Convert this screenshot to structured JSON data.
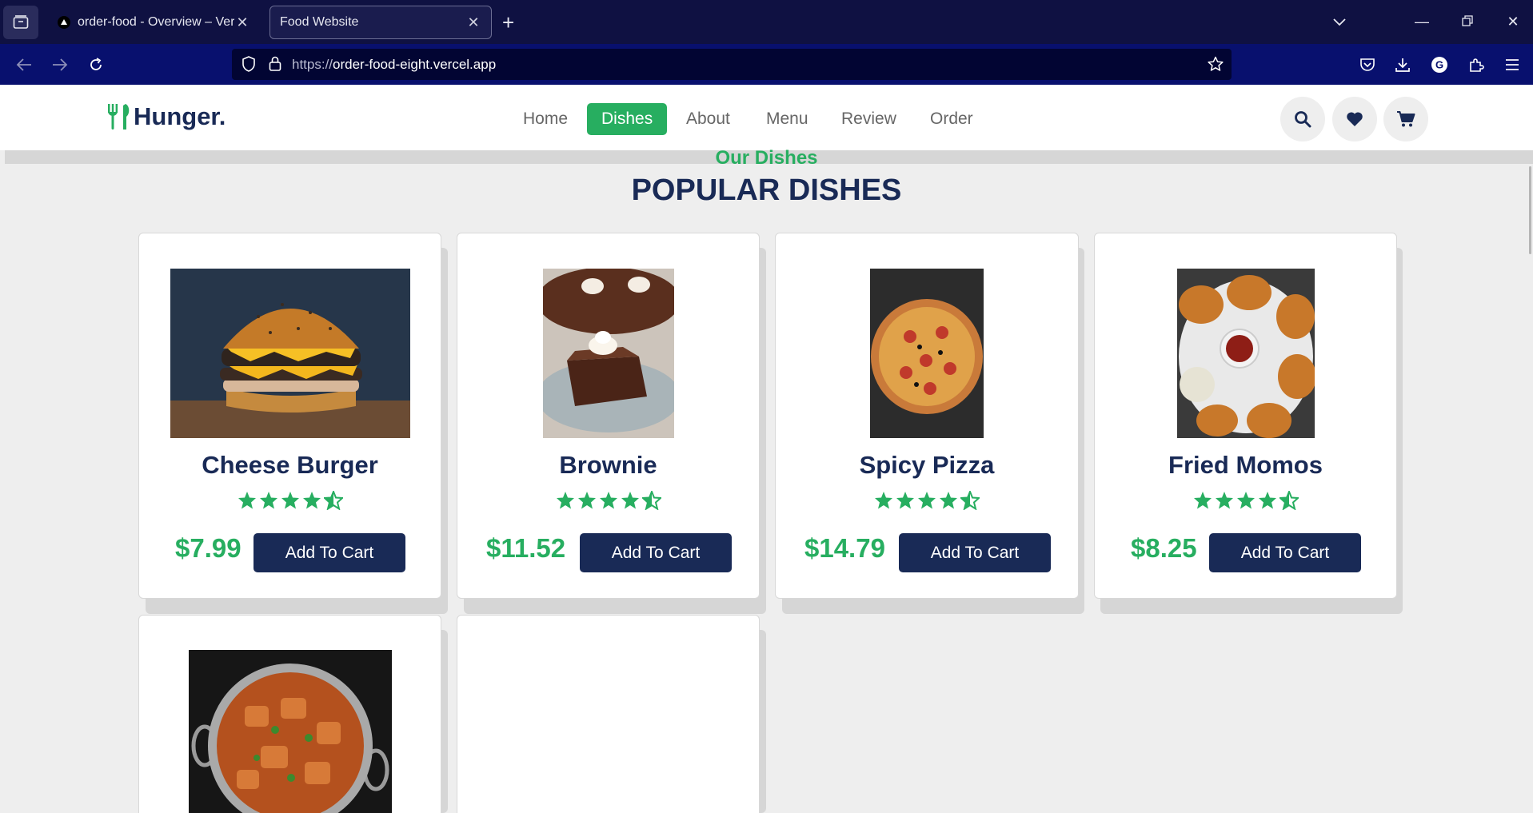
{
  "browser": {
    "tabs": [
      {
        "title": "order-food - Overview – Vercel",
        "active": false
      },
      {
        "title": "Food Website",
        "active": true
      }
    ],
    "url": {
      "protocol": "https://",
      "host": "order-food-eight.vercel.app"
    }
  },
  "site": {
    "logo_text": "Hunger.",
    "nav": [
      "Home",
      "Dishes",
      "About",
      "Menu",
      "Review",
      "Order"
    ],
    "active_nav": "Dishes"
  },
  "section": {
    "subheading": "Our Dishes",
    "heading": "POPULAR DISHES"
  },
  "dishes": [
    {
      "name": "Cheese Burger",
      "rating": 4.5,
      "price": "$7.99",
      "button": "Add To Cart"
    },
    {
      "name": "Brownie",
      "rating": 4.5,
      "price": "$11.52",
      "button": "Add To Cart"
    },
    {
      "name": "Spicy Pizza",
      "rating": 4.5,
      "price": "$14.79",
      "button": "Add To Cart"
    },
    {
      "name": "Fried Momos",
      "rating": 4.5,
      "price": "$8.25",
      "button": "Add To Cart"
    },
    {
      "name": "",
      "rating": null,
      "price": "",
      "button": ""
    },
    {
      "name": "",
      "rating": null,
      "price": "",
      "button": ""
    }
  ],
  "icons": {
    "header_actions": [
      "search-icon",
      "heart-icon",
      "cart-icon"
    ]
  },
  "colors": {
    "brand_green": "#27ae60",
    "brand_navy": "#192a56",
    "browser_tabstrip": "#0f1142",
    "browser_navbar": "#08106e"
  }
}
